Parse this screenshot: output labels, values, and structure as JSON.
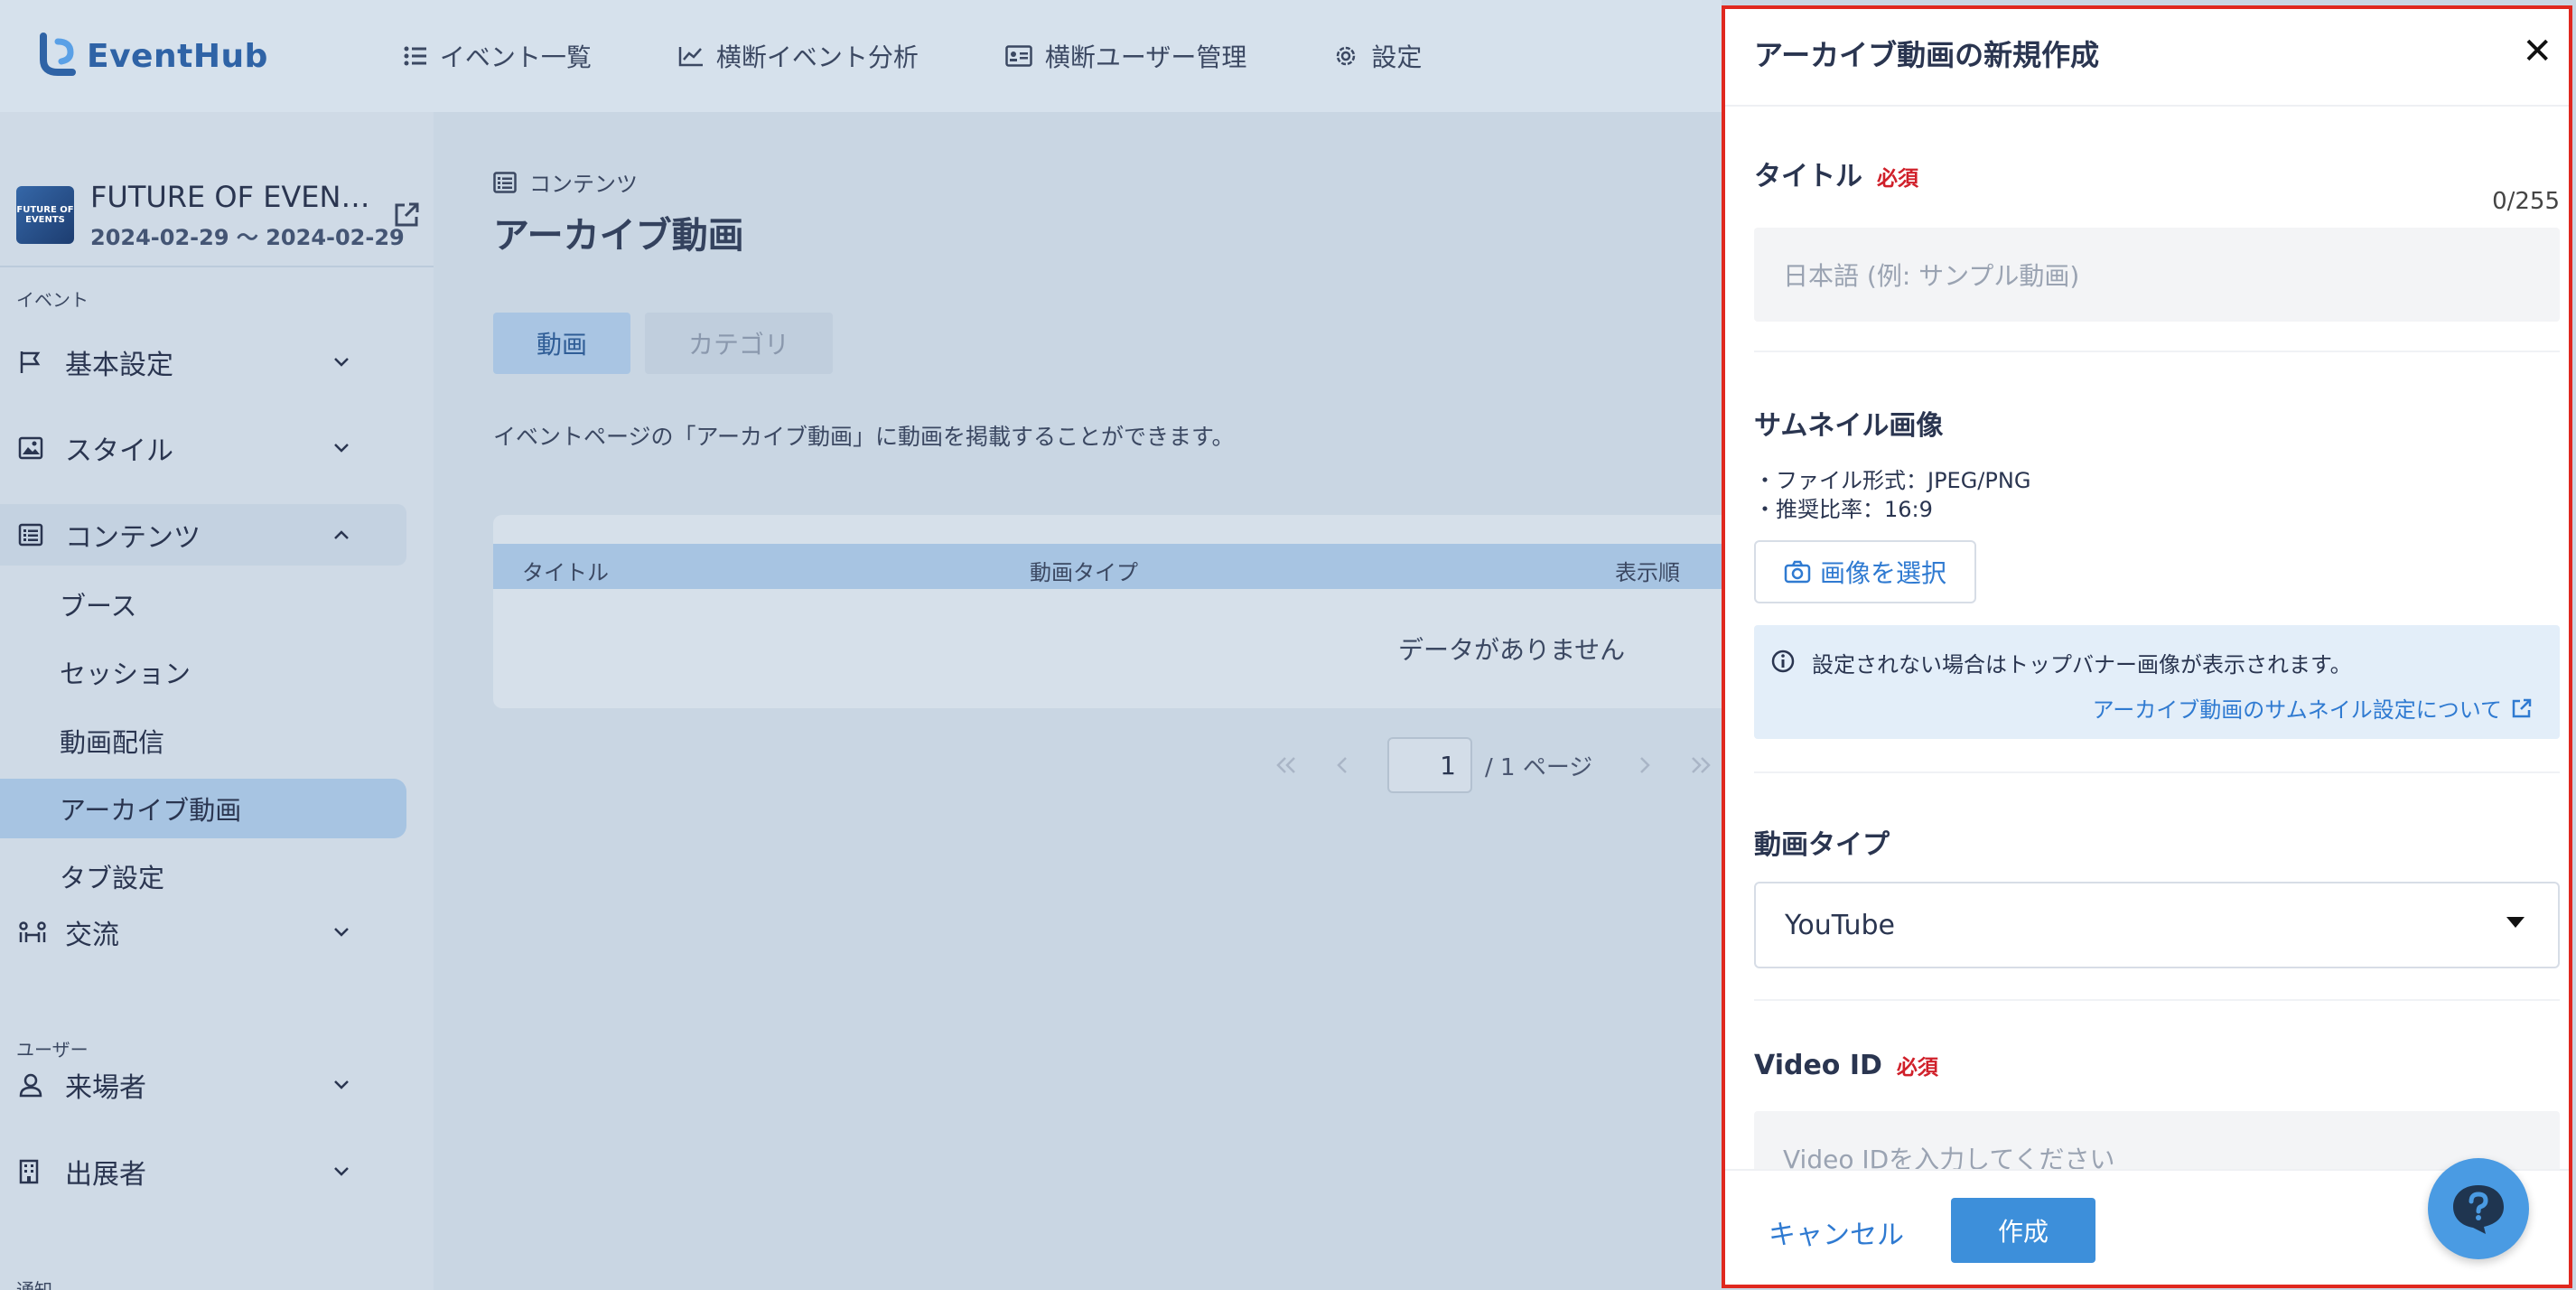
{
  "app": {
    "logo_text": "EventHub"
  },
  "nav": {
    "items": [
      {
        "label": "イベント一覧",
        "icon": "list-icon"
      },
      {
        "label": "横断イベント分析",
        "icon": "chart-line-icon"
      },
      {
        "label": "横断ユーザー管理",
        "icon": "id-card-icon"
      },
      {
        "label": "設定",
        "icon": "gear-icon"
      }
    ]
  },
  "sidebar": {
    "event": {
      "thumb_text": "FUTURE OF EVENTS",
      "name": "FUTURE OF EVEN…",
      "dates": "2024-02-29 〜 2024-02-29"
    },
    "sections": {
      "event_label": "イベント",
      "user_label": "ユーザー",
      "notify_label": "通知"
    },
    "items": [
      {
        "label": "基本設定",
        "icon": "flag-icon"
      },
      {
        "label": "スタイル",
        "icon": "image-icon"
      },
      {
        "label": "コンテンツ",
        "icon": "list-alt-icon"
      },
      {
        "label": "交流",
        "icon": "people-link-icon"
      },
      {
        "label": "来場者",
        "icon": "person-icon"
      },
      {
        "label": "出展者",
        "icon": "building-icon"
      }
    ],
    "sub_items": [
      {
        "label": "ブース"
      },
      {
        "label": "セッション"
      },
      {
        "label": "動画配信"
      },
      {
        "label": "アーカイブ動画"
      },
      {
        "label": "タブ設定"
      }
    ]
  },
  "main": {
    "breadcrumb": "コンテンツ",
    "title": "アーカイブ動画",
    "tabs": [
      {
        "label": "動画"
      },
      {
        "label": "カテゴリ"
      }
    ],
    "description": "イベントページの「アーカイブ動画」に動画を掲載することができます。",
    "table": {
      "columns": [
        "タイトル",
        "動画タイプ",
        "表示順"
      ],
      "empty_text": "データがありません"
    },
    "pagination": {
      "current_page": "1",
      "total_text": "/ 1 ページ"
    }
  },
  "panel": {
    "title": "アーカイブ動画の新規作成",
    "close": "✕",
    "required_badge": "必須",
    "title_field": {
      "label": "タイトル",
      "counter": "0/255",
      "placeholder": "日本語 (例: サンプル動画)"
    },
    "thumbnail": {
      "label": "サムネイル画像",
      "note_format": "・ファイル形式：JPEG/PNG",
      "note_ratio": "・推奨比率：16:9",
      "button_label": "画像を選択",
      "info_text": "設定されない場合はトップバナー画像が表示されます。",
      "info_link": "アーカイブ動画のサムネイル設定について"
    },
    "video_type": {
      "label": "動画タイプ",
      "selected": "YouTube"
    },
    "video_id": {
      "label": "Video ID",
      "placeholder": "Video IDを入力してください"
    },
    "footer": {
      "cancel_label": "キャンセル",
      "create_label": "作成"
    }
  },
  "colors": {
    "accent": "#3d8fda",
    "required": "#d0202a",
    "highlight_border": "#e0281f"
  }
}
